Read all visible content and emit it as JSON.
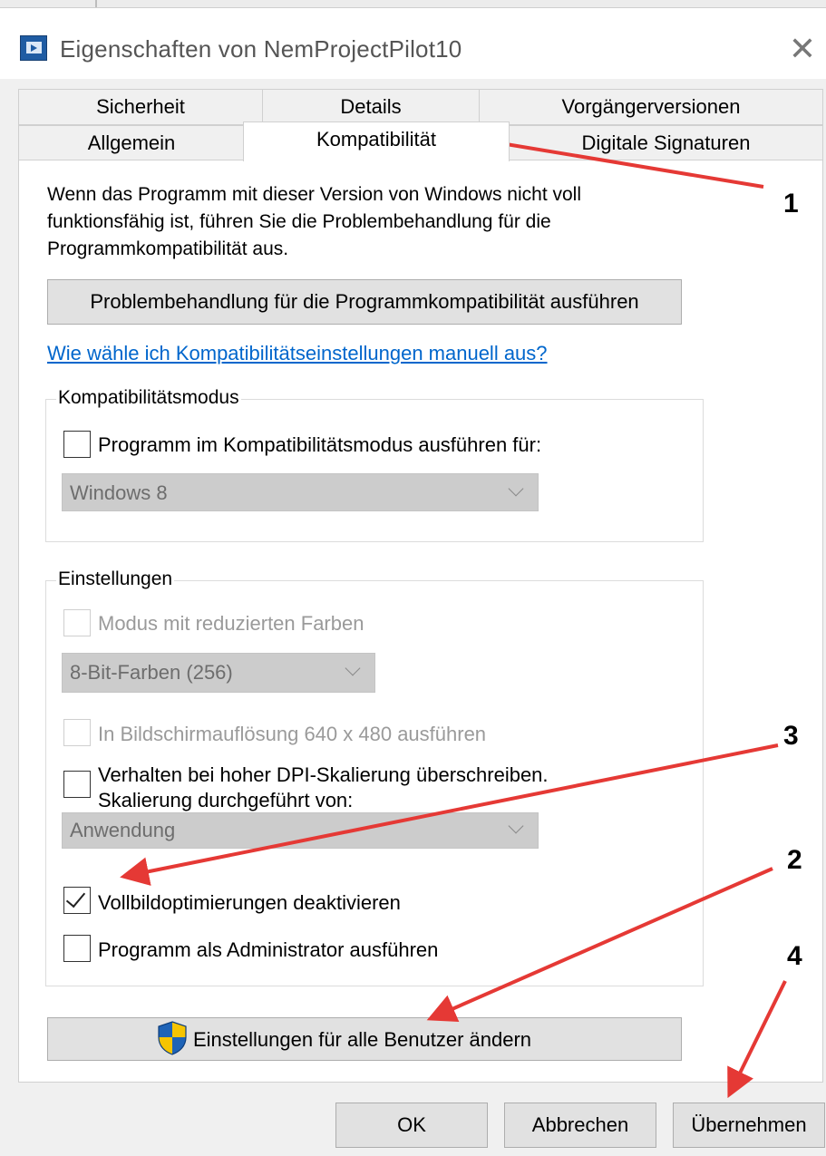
{
  "window": {
    "title": "Eigenschaften von NemProjectPilot10",
    "icon": "app-icon",
    "close_glyph": "✕"
  },
  "tabs": {
    "row1": [
      "Sicherheit",
      "Details",
      "Vorgängerversionen"
    ],
    "row2": [
      "Allgemein",
      "Kompatibilität",
      "Digitale Signaturen"
    ],
    "active": "Kompatibilität"
  },
  "main": {
    "description": "Wenn das Programm mit dieser Version von Windows nicht voll funktionsfähig ist, führen Sie die Problembehandlung für die Programmkompatibilität aus.",
    "troubleshoot_button": "Problembehandlung für die Programmkompatibilität ausführen",
    "help_link": "Wie wähle ich Kompatibilitätseinstellungen manuell aus?"
  },
  "compat_mode": {
    "legend": "Kompatibilitätsmodus",
    "checkbox_label": "Programm im Kompatibilitätsmodus ausführen für:",
    "checked": false,
    "select_value": "Windows 8"
  },
  "settings": {
    "legend": "Einstellungen",
    "reduced_colors_label": "Modus mit reduzierten Farben",
    "color_select_value": "8-Bit-Farben (256)",
    "resolution_label": "In Bildschirmauflösung 640 x 480 ausführen",
    "dpi_label_line1": "Verhalten bei hoher DPI-Skalierung überschreiben.",
    "dpi_label_line2": "Skalierung durchgeführt von:",
    "dpi_select_value": "Anwendung",
    "fullscreen_label": "Vollbildoptimierungen deaktivieren",
    "fullscreen_checked": true,
    "admin_label": "Programm als Administrator ausführen",
    "admin_checked": false
  },
  "change_all_users_button": "Einstellungen für alle Benutzer ändern",
  "footer": {
    "ok": "OK",
    "cancel": "Abbrechen",
    "apply": "Übernehmen"
  },
  "annotations": {
    "labels": [
      "1",
      "2",
      "3",
      "4"
    ],
    "arrow_color": "#e53935"
  },
  "colors": {
    "link": "#0066cc",
    "shield_blue": "#1e63b7",
    "shield_yellow": "#f6c400"
  }
}
